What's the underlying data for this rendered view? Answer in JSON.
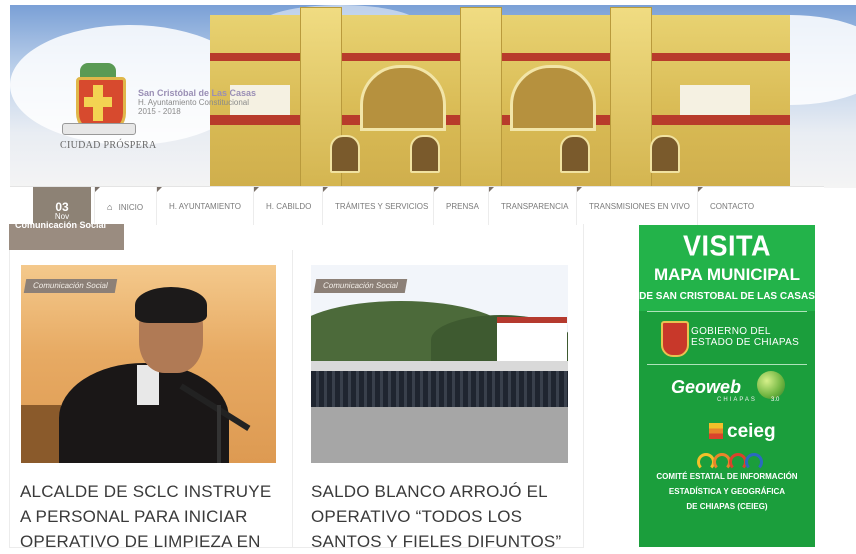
{
  "header": {
    "city_title": "San Cristóbal de Las Casas",
    "city_subtitle": "H. Ayuntamiento Constitucional",
    "city_years": "2015 - 2018",
    "motto": "CIUDAD PRÓSPERA",
    "crest_icon": "municipal-crest-icon"
  },
  "nav": {
    "date_day": "03",
    "date_month": "Nov",
    "home_icon": "home-icon",
    "items": [
      {
        "label": "INICIO"
      },
      {
        "label": "H. AYUNTAMIENTO"
      },
      {
        "label": "H. CABILDO"
      },
      {
        "label": "TRÁMITES Y SERVICIOS"
      },
      {
        "label": "PRENSA"
      },
      {
        "label": "TRANSPARENCIA"
      },
      {
        "label": "TRANSMISIONES EN VIVO"
      },
      {
        "label": "CONTACTO"
      }
    ]
  },
  "section": {
    "category": "Comunicación Social"
  },
  "posts": [
    {
      "tag": "Comunicación Social",
      "title": "ALCALDE DE SCLC INSTRUYE A PERSONAL PARA INICIAR OPERATIVO DE LIMPIEZA EN"
    },
    {
      "tag": "Comunicación Social",
      "title": "SALDO BLANCO ARROJÓ EL OPERATIVO “TODOS LOS SANTOS Y FIELES DIFUNTOS”"
    }
  ],
  "sidebar_banner": {
    "visita": "VISITA",
    "mapa": "MAPA MUNICIPAL",
    "location": "DE SAN CRISTOBAL DE LAS CASAS",
    "gobierno_line1": "GOBIERNO DEL",
    "gobierno_line2": "ESTADO DE CHIAPAS",
    "geoweb": "Geoweb",
    "geoweb_sub": "CHIAPAS",
    "geoweb_version": "3.0",
    "ceieg": "ceieg",
    "comite_line1": "COMITÉ ESTATAL DE INFORMACIÓN",
    "comite_line2": "ESTADÍSTICA Y GEOGRÁFICA",
    "comite_line3": "DE CHIAPAS (CEIEG)",
    "colors": {
      "bg": "#1b9e3c",
      "top": "#23b34a"
    }
  }
}
